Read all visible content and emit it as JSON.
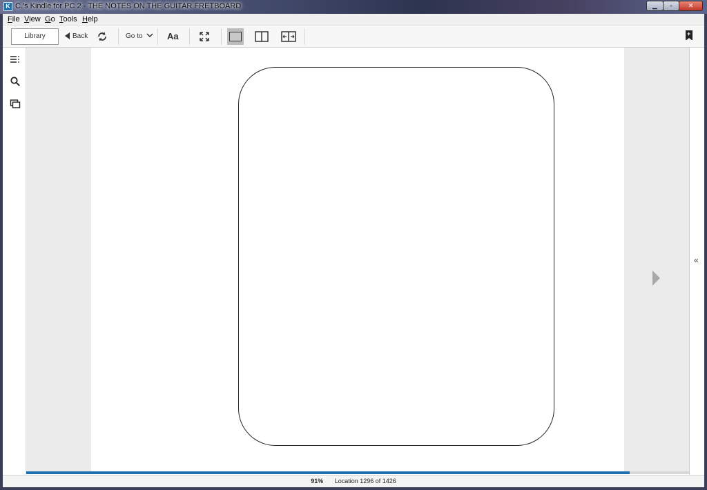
{
  "window": {
    "title": "C.'s Kindle for PC 2 - THE NOTES ON THE GUITAR FRETBOARD",
    "app_icon_letter": "K",
    "controls": {
      "minimize": "▁",
      "maximize": "▫",
      "close": "✕"
    }
  },
  "menubar": {
    "items": [
      {
        "accel": "F",
        "rest": "ile"
      },
      {
        "accel": "V",
        "rest": "iew"
      },
      {
        "accel": "G",
        "rest": "o"
      },
      {
        "accel": "T",
        "rest": "ools"
      },
      {
        "accel": "H",
        "rest": "elp"
      }
    ]
  },
  "toolbar": {
    "library_label": "Library",
    "back_label": "Back",
    "goto_label": "Go to",
    "font_label": "Aa",
    "bookmark_glyph": "+"
  },
  "icons": {
    "toc": "toc-icon",
    "search": "search-icon",
    "flashcards": "flashcards-icon",
    "sync": "sync-icon",
    "fullscreen": "fullscreen-icon",
    "collapse": "collapse-icon"
  },
  "sidebar_right": {
    "collapse_glyph": "«"
  },
  "status": {
    "progress_percent": 91,
    "percent_label": "91%",
    "location_label": "Location 1296 of 1426"
  },
  "colors": {
    "accent": "#1f70b0",
    "active_view": "#bdbdbd",
    "page_margin": "#ebebeb"
  }
}
